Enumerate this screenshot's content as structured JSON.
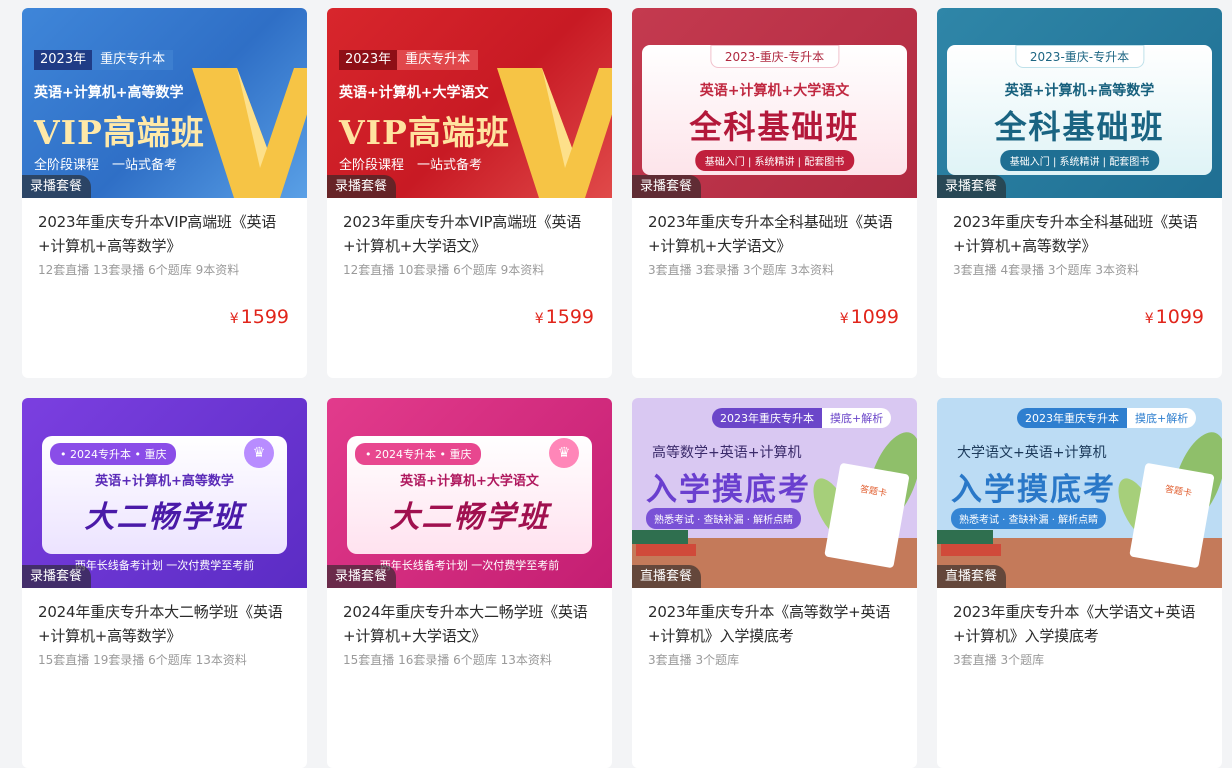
{
  "courses": [
    {
      "badge": "录播套餐",
      "title": "2023年重庆专升本VIP高端班《英语+计算机+高等数学》",
      "meta": "12套直播 13套录播 6个题库 9本资料",
      "currency": "¥",
      "price": "1599",
      "banner": {
        "year": "2023年",
        "place": "重庆专升本",
        "subjects": "英语+计算机+高等数学",
        "name": "VIP高端班",
        "footer": "全阶段课程　一站式备考"
      }
    },
    {
      "badge": "录播套餐",
      "title": "2023年重庆专升本VIP高端班《英语+计算机+大学语文》",
      "meta": "12套直播 10套录播 6个题库 9本资料",
      "currency": "¥",
      "price": "1599",
      "banner": {
        "year": "2023年",
        "place": "重庆专升本",
        "subjects": "英语+计算机+大学语文",
        "name": "VIP高端班",
        "footer": "全阶段课程　一站式备考"
      }
    },
    {
      "badge": "录播套餐",
      "title": "2023年重庆专升本全科基础班《英语+计算机+大学语文》",
      "meta": "3套直播 3套录播 3个题库 3本资料",
      "currency": "¥",
      "price": "1099",
      "banner": {
        "chip": "2023-重庆-专升本",
        "subjects": "英语+计算机+大学语文",
        "name": "全科基础班",
        "footer": "基础入门 | 系统精讲 | 配套图书"
      }
    },
    {
      "badge": "录播套餐",
      "title": "2023年重庆专升本全科基础班《英语+计算机+高等数学》",
      "meta": "3套直播 4套录播 3个题库 3本资料",
      "currency": "¥",
      "price": "1099",
      "banner": {
        "chip": "2023-重庆-专升本",
        "subjects": "英语+计算机+高等数学",
        "name": "全科基础班",
        "footer": "基础入门 | 系统精讲 | 配套图书"
      }
    },
    {
      "badge": "录播套餐",
      "title": "2024年重庆专升本大二畅学班《英语+计算机+高等数学》",
      "meta": "15套直播 19套录播 6个题库 13本资料",
      "banner": {
        "chip": "• 2024专升本 • 重庆",
        "subjects": "英语+计算机+高等数学",
        "name": "大二畅学班",
        "footer": "两年长线备考计划 一次付费学至考前"
      }
    },
    {
      "badge": "录播套餐",
      "title": "2024年重庆专升本大二畅学班《英语+计算机+大学语文》",
      "meta": "15套直播 16套录播 6个题库 13本资料",
      "banner": {
        "chip": "• 2024专升本 • 重庆",
        "subjects": "英语+计算机+大学语文",
        "name": "大二畅学班",
        "footer": "两年长线备考计划 一次付费学至考前"
      }
    },
    {
      "badge": "直播套餐",
      "title": "2023年重庆专升本《高等数学+英语+计算机》入学摸底考",
      "meta": "3套直播 3个题库",
      "banner": {
        "chip_a": "2023年重庆专升本",
        "chip_b": "摸底+解析",
        "subjects": "高等数学+英语+计算机",
        "name": "入学摸底考",
        "footer": "熟悉考试 · 查缺补漏 · 解析点睛",
        "paper": "答题卡"
      }
    },
    {
      "badge": "直播套餐",
      "title": "2023年重庆专升本《大学语文+英语+计算机》入学摸底考",
      "meta": "3套直播 3个题库",
      "banner": {
        "chip_a": "2023年重庆专升本",
        "chip_b": "摸底+解析",
        "subjects": "大学语文+英语+计算机",
        "name": "入学摸底考",
        "footer": "熟悉考试 · 查缺补漏 · 解析点睛",
        "paper": "答题卡"
      }
    }
  ]
}
